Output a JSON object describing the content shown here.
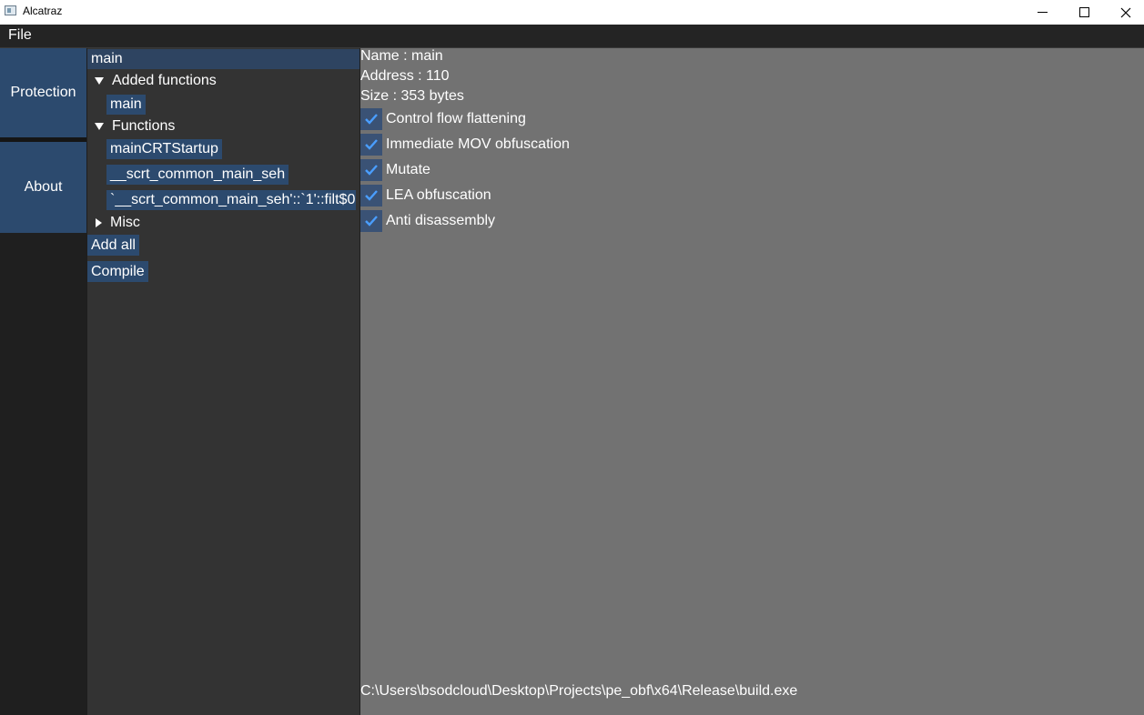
{
  "window": {
    "title": "Alcatraz"
  },
  "menu": {
    "file": "File"
  },
  "nav": {
    "protection": "Protection",
    "about": "About"
  },
  "tree": {
    "search_value": "main",
    "added_group": "Added functions",
    "added_items": [
      "main"
    ],
    "functions_group": "Functions",
    "function_items": [
      "mainCRTStartup",
      "__scrt_common_main_seh",
      "`__scrt_common_main_seh'::`1'::filt$0"
    ],
    "misc_group": "Misc",
    "add_all": "Add all",
    "compile": "Compile"
  },
  "details": {
    "name": "Name : main",
    "address": "Address : 110",
    "size": "Size : 353 bytes",
    "options": [
      {
        "label": "Control flow flattening",
        "checked": true
      },
      {
        "label": "Immediate MOV obfuscation",
        "checked": true
      },
      {
        "label": "Mutate",
        "checked": true
      },
      {
        "label": "LEA obfuscation",
        "checked": true
      },
      {
        "label": "Anti disassembly",
        "checked": true
      }
    ],
    "path": "C:\\Users\\bsodcloud\\Desktop\\Projects\\pe_obf\\x64\\Release\\build.exe"
  },
  "colors": {
    "accent": "#2c4a6e",
    "check": "#4a9eff",
    "panel_bg": "#333333",
    "detail_bg": "#727272"
  }
}
